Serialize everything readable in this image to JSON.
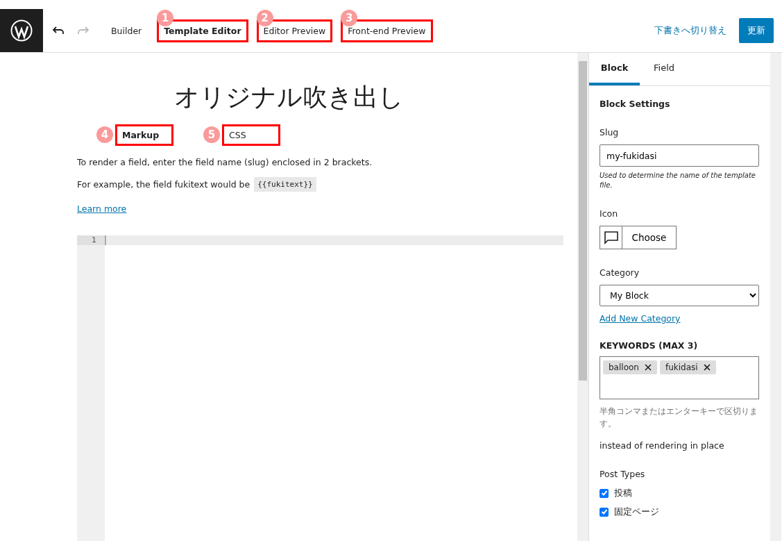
{
  "toolbar": {
    "tabs": [
      {
        "label": "Builder",
        "selected": false
      },
      {
        "label": "Template Editor",
        "selected": true,
        "callout": "1"
      },
      {
        "label": "Editor Preview",
        "selected": false,
        "callout": "2"
      },
      {
        "label": "Front-end Preview",
        "selected": false,
        "callout": "3"
      }
    ],
    "draft_link": "下書きへ切り替え",
    "update_button": "更新"
  },
  "editor": {
    "title": "オリジナル吹き出し",
    "tabs": [
      {
        "label": "Markup",
        "selected": true,
        "callout": "4"
      },
      {
        "label": "CSS",
        "selected": false,
        "callout": "5"
      }
    ],
    "help": "To render a field, enter the field name (slug) enclosed in 2 brackets.",
    "example": "For example, the field fukitext would be",
    "example_code": "{{fukitext}}",
    "learn_more": "Learn more",
    "line_numbers": [
      "1"
    ]
  },
  "sidebar": {
    "tabs": [
      {
        "label": "Block",
        "selected": true
      },
      {
        "label": "Field",
        "selected": false
      }
    ],
    "section_title": "Block Settings",
    "slug": {
      "label": "Slug",
      "value": "my-fukidasi",
      "help": "Used to determine the name of the template file."
    },
    "icon": {
      "label": "Icon",
      "button": "Choose"
    },
    "category": {
      "label": "Category",
      "value": "My Block",
      "link": "Add New Category"
    },
    "keywords": {
      "label": "KEYWORDS (MAX 3)",
      "tags": [
        "balloon",
        "fukidasi"
      ],
      "hint": "半角コンマまたはエンターキーで区切ります。"
    },
    "note": "instead of rendering in place",
    "post_types": {
      "label": "Post Types",
      "items": [
        {
          "label": "投稿",
          "checked": true
        },
        {
          "label": "固定ページ",
          "checked": true
        }
      ]
    }
  }
}
